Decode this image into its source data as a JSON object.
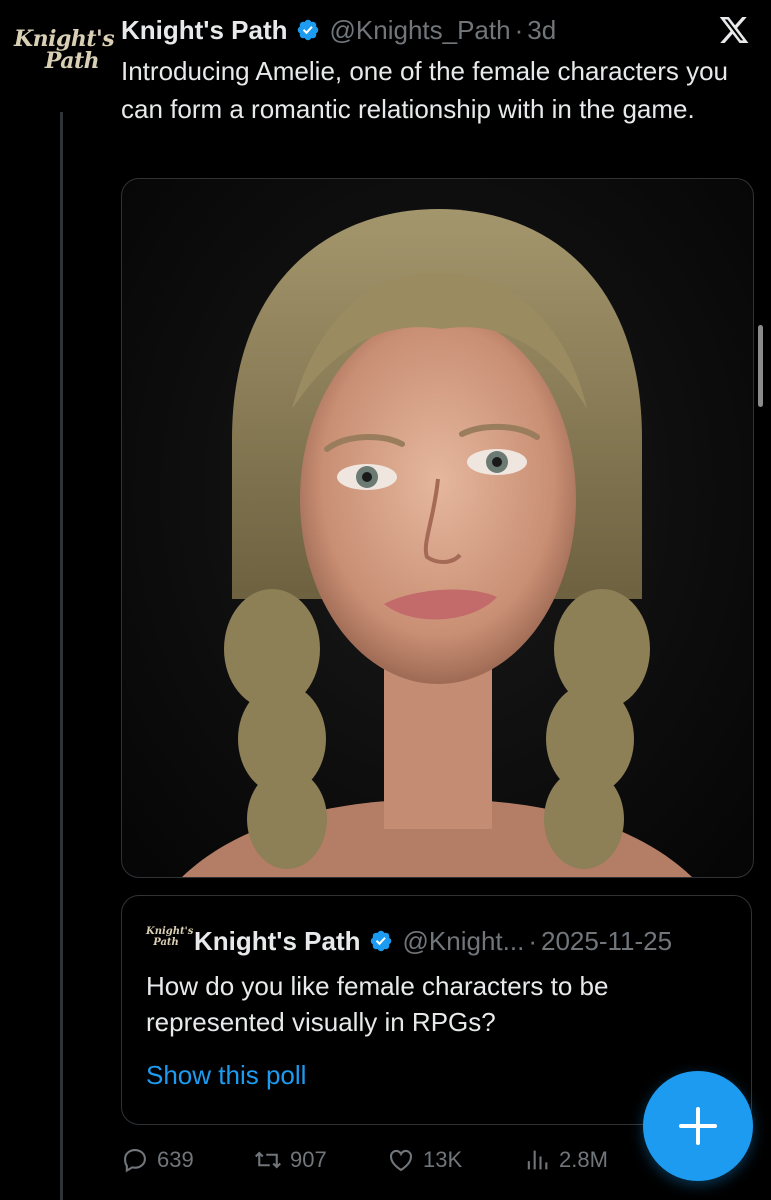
{
  "post": {
    "author_name": "Knight's Path",
    "handle": "@Knights_Path",
    "time_sep": "·",
    "time": "3d",
    "text": "Introducing Amelie, one of the female characters you can form a romantic relationship with in the game.",
    "avatar_logo_line1": "Knight's",
    "avatar_logo_line2": "Path",
    "media_icon": "portrait-image"
  },
  "quote": {
    "author_name": "Knight's Path",
    "handle": "@Knight...",
    "time_sep": "·",
    "date": "2025-11-25",
    "text": "How do you like female characters to be represented visually in RPGs?",
    "link": "Show this poll",
    "avatar_logo_line1": "Knight's",
    "avatar_logo_line2": "Path"
  },
  "actions": {
    "replies": "639",
    "reposts": "907",
    "likes": "13K",
    "views": "2.8M"
  },
  "icons": {
    "verified": "verified-badge-icon",
    "x_logo": "x-logo-icon",
    "compose": "plus-icon"
  },
  "colors": {
    "background": "#000000",
    "text": "#e7e9ea",
    "muted": "#71767b",
    "accent": "#1d9bf0",
    "border": "#2f3336"
  }
}
